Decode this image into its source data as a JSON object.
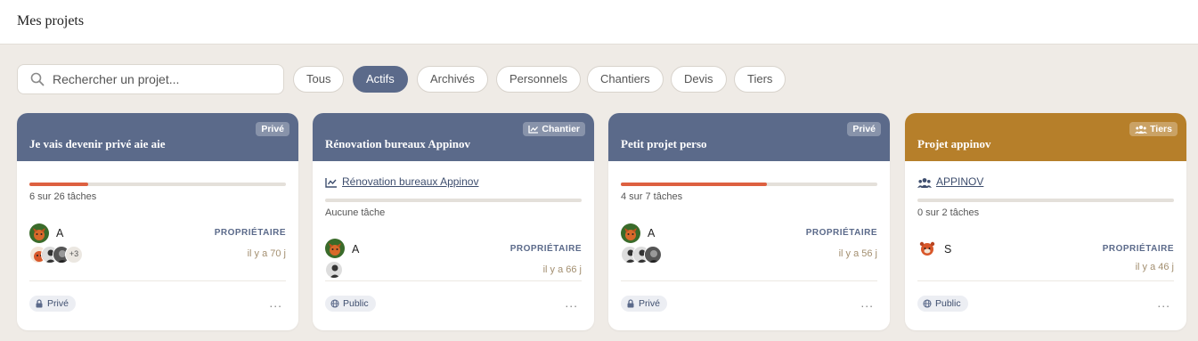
{
  "header": {
    "title": "Mes projets"
  },
  "search": {
    "placeholder": "Rechercher un projet..."
  },
  "filters": [
    "Tous",
    "Actifs",
    "Archivés",
    "Personnels",
    "Chantiers",
    "Devis",
    "Tiers"
  ],
  "active_filter": "Actifs",
  "colors": {
    "header_blue": "#5b6a8a",
    "header_gold": "#b67f2a",
    "progress": "#dd6040",
    "background": "#efebe6"
  },
  "cards": [
    {
      "title": "Je vais devenir privé aie aie",
      "badge": "Privé",
      "progress_text": "6 sur 26 tâches",
      "progress": 0.23,
      "owner_name": "A",
      "role": "PROPRIÉTAIRE",
      "ago": "il y a 70 j",
      "members_more": "+3",
      "visibility": "Privé",
      "more_icon": "..."
    },
    {
      "title": "Rénovation bureaux Appinov",
      "badge": "Chantier",
      "link": "Rénovation bureaux Appinov",
      "progress_text": "Aucune tâche",
      "progress": 0,
      "owner_name": "A",
      "role": "PROPRIÉTAIRE",
      "ago": "il y a 66 j",
      "visibility": "Public",
      "more_icon": "..."
    },
    {
      "title": "Petit projet perso",
      "badge": "Privé",
      "progress_text": "4 sur 7 tâches",
      "progress": 0.57,
      "owner_name": "A",
      "role": "PROPRIÉTAIRE",
      "ago": "il y a 56 j",
      "visibility": "Privé",
      "more_icon": "..."
    },
    {
      "title": "Projet appinov",
      "badge": "Tiers",
      "link": "APPINOV",
      "progress_text": "0 sur 2 tâches",
      "progress": 0,
      "owner_name": "S",
      "role": "PROPRIÉTAIRE",
      "ago": "il y a 46 j",
      "visibility": "Public",
      "more_icon": "..."
    }
  ]
}
